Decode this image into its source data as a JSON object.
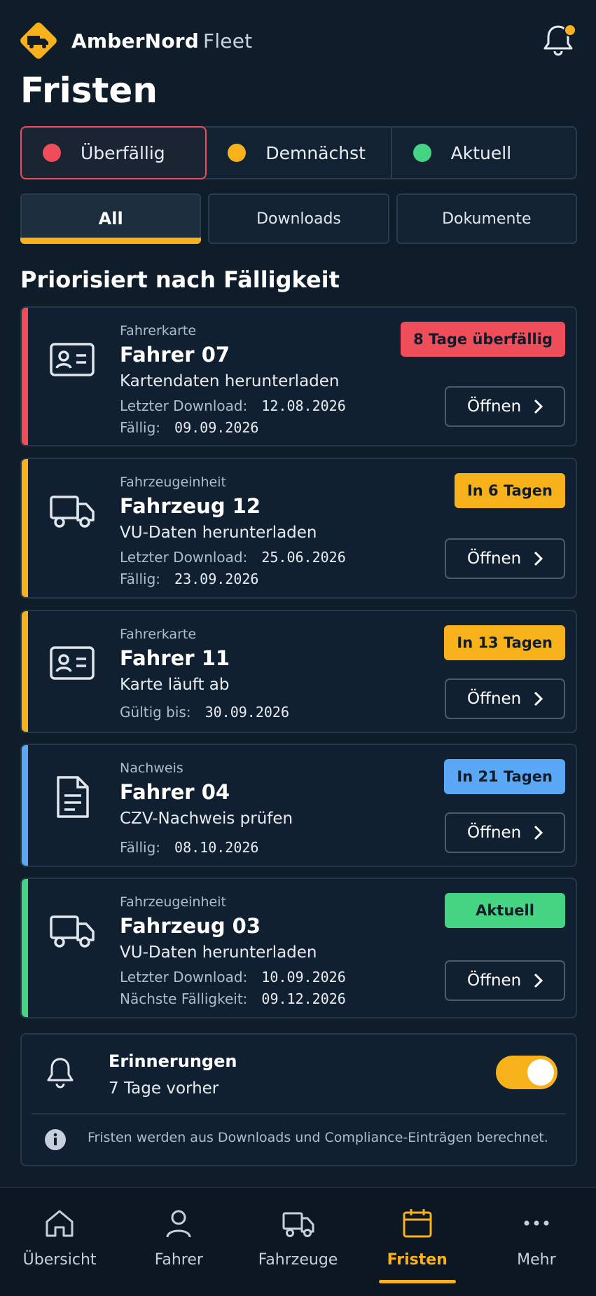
{
  "app": {
    "brand": "AmberNord",
    "brand_sub": "Fleet"
  },
  "colors": {
    "accent": "#f7b21b",
    "overdue": "#ef4d5a",
    "soon": "#f7b21b",
    "info": "#5aa8f5",
    "current": "#45d483"
  },
  "page_title": "Fristen",
  "status_filters": [
    {
      "label": "Überfällig"
    },
    {
      "label": "Demnächst"
    },
    {
      "label": "Aktuell"
    }
  ],
  "tabs": [
    {
      "label": "All"
    },
    {
      "label": "Downloads"
    },
    {
      "label": "Dokumente"
    }
  ],
  "section_title": "Priorisiert nach Fälligkeit",
  "open_label": "Öffnen",
  "cards": [
    {
      "category": "Fahrerkarte",
      "name": "Fahrer 07",
      "task": "Kartendaten herunterladen",
      "badge": "8 Tage überfällig",
      "icon": "id-card-icon",
      "meta": [
        {
          "label": "Letzter Download:",
          "value": "12.08.2026"
        },
        {
          "label": "Fällig:",
          "value": "09.09.2026"
        }
      ]
    },
    {
      "category": "Fahrzeugeinheit",
      "name": "Fahrzeug 12",
      "task": "VU-Daten herunterladen",
      "badge": "In 6 Tagen",
      "icon": "truck-icon",
      "meta": [
        {
          "label": "Letzter Download:",
          "value": "25.06.2026"
        },
        {
          "label": "Fällig:",
          "value": "23.09.2026"
        }
      ]
    },
    {
      "category": "Fahrerkarte",
      "name": "Fahrer 11",
      "task": "Karte läuft ab",
      "badge": "In 13 Tagen",
      "icon": "id-card-icon",
      "meta": [
        {
          "label": "Gültig bis:",
          "value": "30.09.2026"
        }
      ]
    },
    {
      "category": "Nachweis",
      "name": "Fahrer 04",
      "task": "CZV-Nachweis prüfen",
      "badge": "In 21 Tagen",
      "icon": "document-icon",
      "meta": [
        {
          "label": "Fällig:",
          "value": "08.10.2026"
        }
      ]
    },
    {
      "category": "Fahrzeugeinheit",
      "name": "Fahrzeug 03",
      "task": "VU-Daten herunterladen",
      "badge": "Aktuell",
      "icon": "truck-icon",
      "meta": [
        {
          "label": "Letzter Download:",
          "value": "10.09.2026"
        },
        {
          "label": "Nächste Fälligkeit:",
          "value": "09.12.2026"
        }
      ]
    }
  ],
  "reminder": {
    "title": "Erinnerungen",
    "subtitle": "7 Tage vorher",
    "enabled": true,
    "info": "Fristen werden aus Downloads und Compliance-Einträgen berechnet."
  },
  "nav": [
    {
      "label": "Übersicht"
    },
    {
      "label": "Fahrer"
    },
    {
      "label": "Fahrzeuge"
    },
    {
      "label": "Fristen"
    },
    {
      "label": "Mehr"
    }
  ]
}
